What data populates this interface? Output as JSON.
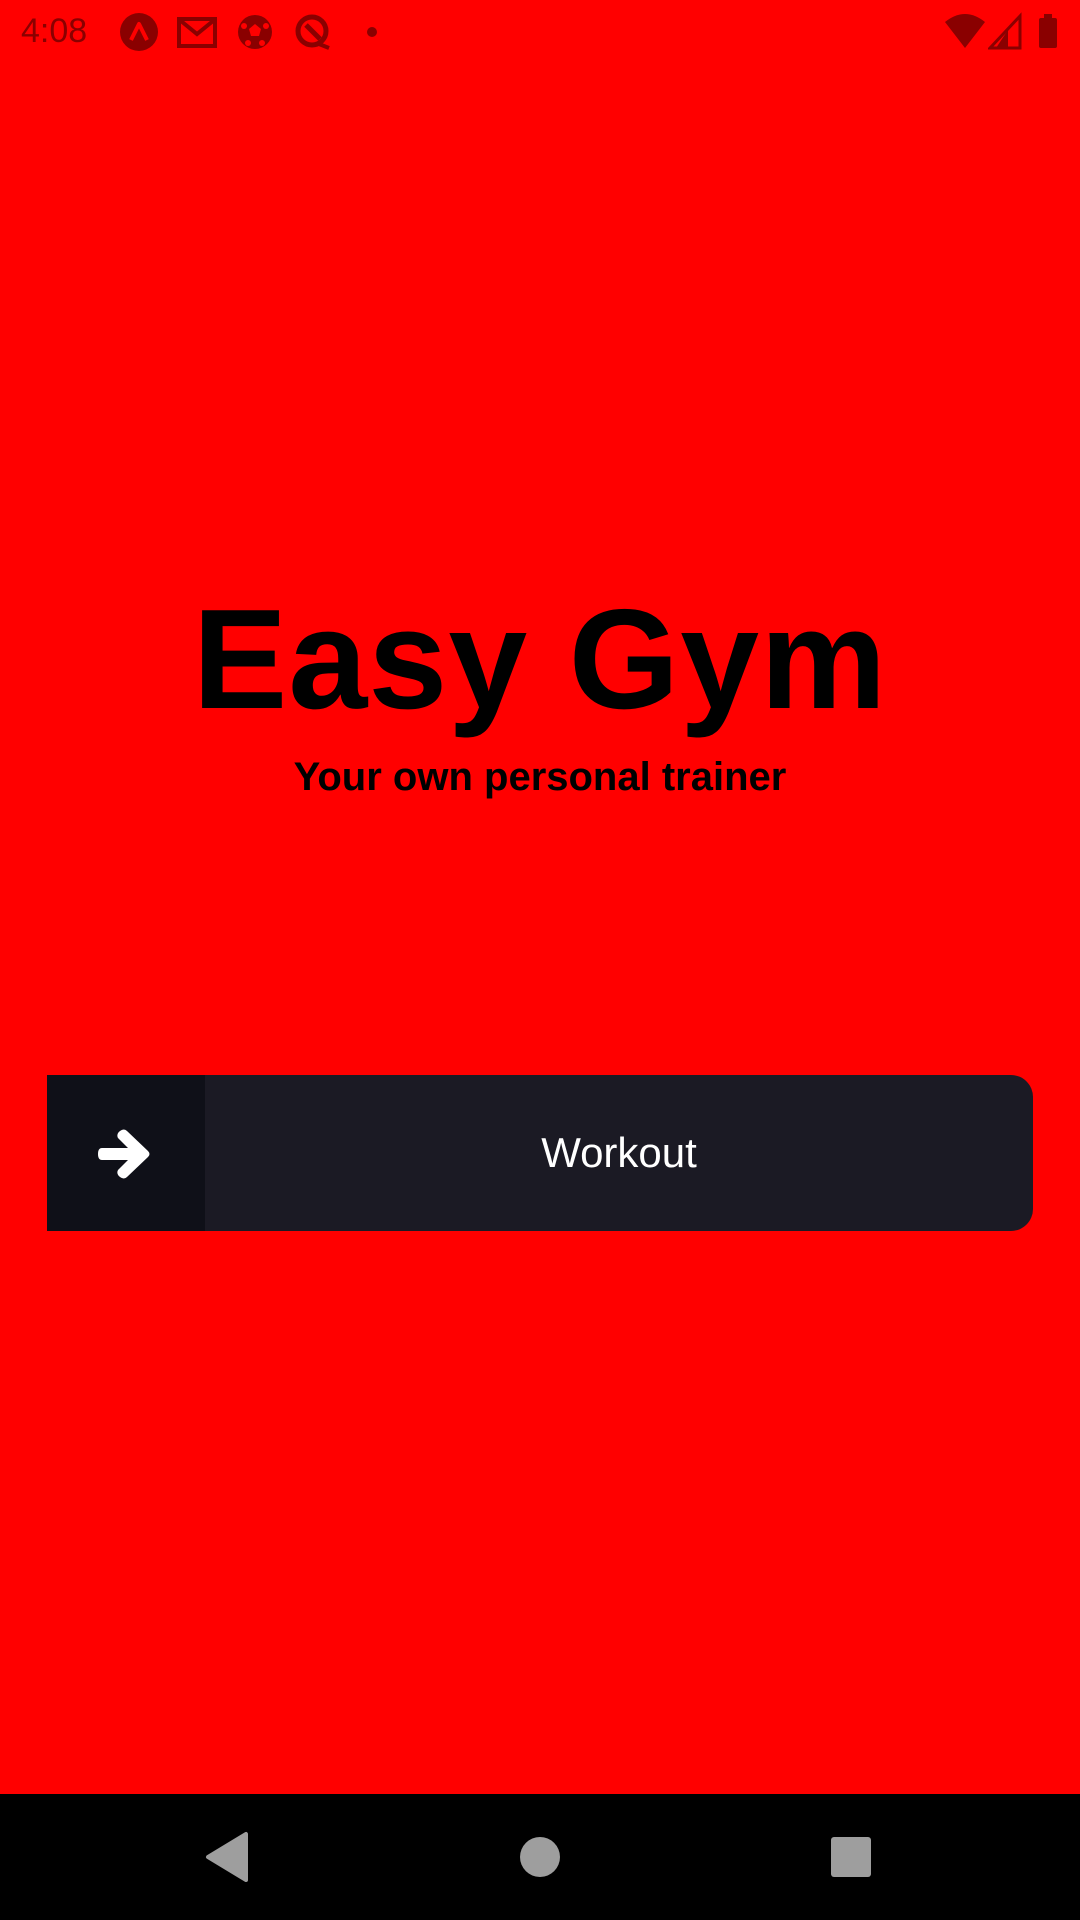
{
  "status_bar": {
    "time": "4:08",
    "notification_icons": [
      "a-app-icon",
      "gmail-icon",
      "soccer-ball-icon",
      "q-app-icon",
      "dot-icon"
    ],
    "system_icons": [
      "wifi-icon",
      "signal-icon",
      "battery-icon"
    ]
  },
  "main": {
    "title": "Easy Gym",
    "subtitle": "Your own personal trainer",
    "workout_button": {
      "label": "Workout",
      "icon": "arrow-right-icon"
    }
  },
  "nav_bar": {
    "buttons": [
      "back-icon",
      "home-icon",
      "recents-icon"
    ]
  },
  "colors": {
    "background": "#ff0000",
    "button_bg": "#1b1a24",
    "button_icon_bg": "#0f1018",
    "text_primary": "#000000",
    "button_text": "#ffffff",
    "status_icons": "#8a0000"
  }
}
